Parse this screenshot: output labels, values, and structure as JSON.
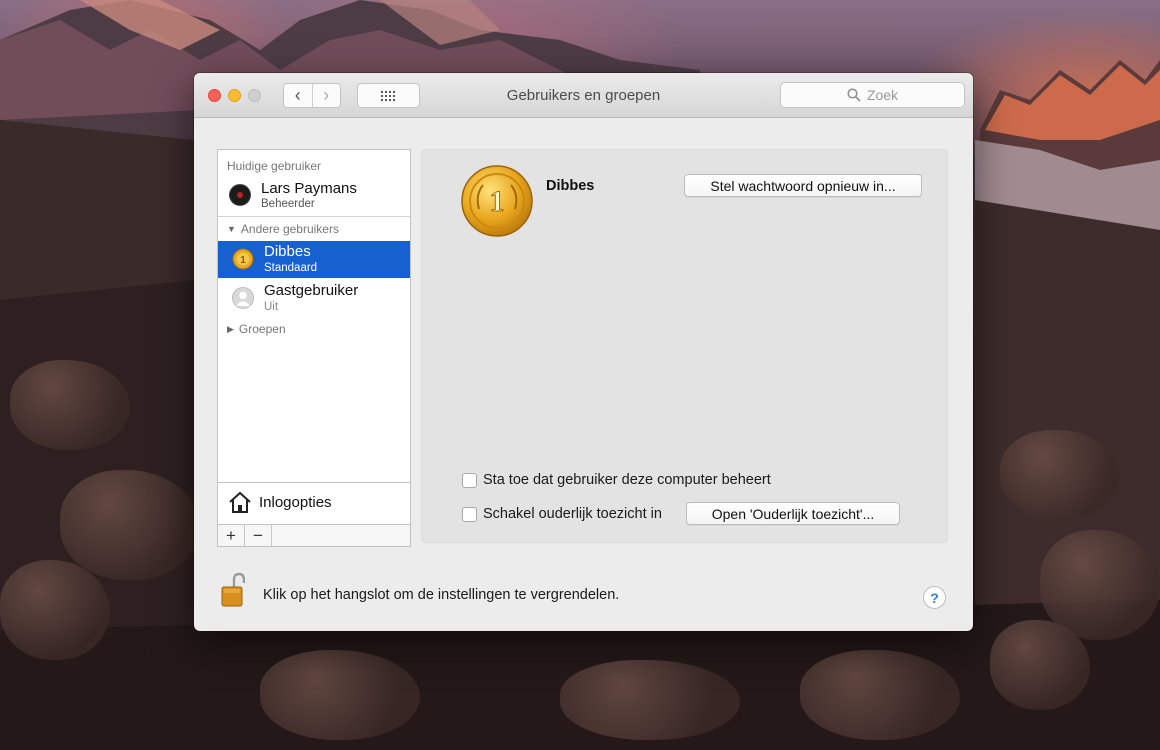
{
  "window": {
    "title": "Gebruikers en groepen"
  },
  "toolbar": {
    "search_placeholder": "Zoek"
  },
  "sidebar": {
    "current_user_header": "Huidige gebruiker",
    "current_user": {
      "name": "Lars Paymans",
      "role": "Beheerder"
    },
    "other_users_header": "Andere gebruikers",
    "other_users": [
      {
        "name": "Dibbes",
        "role": "Standaard",
        "selected": true
      },
      {
        "name": "Gastgebruiker",
        "role": "Uit",
        "selected": false
      }
    ],
    "groups_label": "Groepen",
    "login_options_label": "Inlogopties",
    "add_label": "+",
    "remove_label": "−"
  },
  "detail": {
    "user_name": "Dibbes",
    "reset_password_label": "Stel wachtwoord opnieuw in...",
    "allow_admin_label": "Sta toe dat gebruiker deze computer beheert",
    "allow_admin_checked": false,
    "parental_controls_label": "Schakel ouderlijk toezicht in",
    "parental_controls_checked": false,
    "open_parental_label": "Open 'Ouderlijk toezicht'..."
  },
  "footer": {
    "lock_text": "Klik op het hangslot om de instellingen te vergrendelen.",
    "help_label": "?"
  },
  "colors": {
    "selection": "#1660d0",
    "close": "#fc5f57",
    "minimize": "#fdbb2e"
  }
}
